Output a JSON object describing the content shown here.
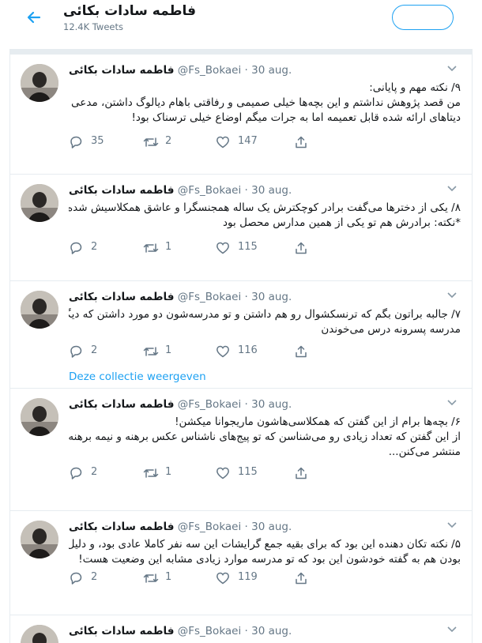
{
  "header": {
    "name": "فاطمه سادات بکائی",
    "tweet_count": "12.4K Tweets"
  },
  "tweets": [
    {
      "name": "فاطمه سادات بکائی",
      "handle": "@Fs_Bokaei",
      "date": "· 30 aug.",
      "lines": [
        "۹/ نکته مهم و پایانی:",
        "من قصد پژوهش نداشتم و این بچه‌ها خیلی صمیمی و رفاقتی باهام دیالوگ داشتن، مدعی این هم نیستم که",
        "دیتاهای ارائه شده قابل تعمیمه اما به جرات میگم اوضاع خیلی ترسناک بود!"
      ],
      "replies": "35",
      "retweets": "2",
      "likes": "147"
    },
    {
      "name": "فاطمه سادات بکائی",
      "handle": "@Fs_Bokaei",
      "date": "· 30 aug.",
      "lines": [
        "۸/ یکی از دخترها می‌گفت برادر کوچکترش یک ساله همجنسگرا و عاشق همکلاسیش شده!!!!!",
        "*نکته: برادرش هم تو یکی از همین مدارس محصل بود"
      ],
      "replies": "2",
      "retweets": "1",
      "likes": "115"
    },
    {
      "name": "فاطمه سادات بکائی",
      "handle": "@Fs_Bokaei",
      "date": "· 30 aug.",
      "lines": [
        "۷/ جالبه براتون بگم که ترنسکشوال رو هم داشتن و تو مدرسه‌شون دو مورد داشتن که دیگه امسال رو",
        "مدرسه پسرونه درس می‌خوندن"
      ],
      "replies": "2",
      "retweets": "1",
      "likes": "116",
      "collection_link": "Deze collectie weergeven"
    },
    {
      "name": "فاطمه سادات بکائی",
      "handle": "@Fs_Bokaei",
      "date": "· 30 aug.",
      "lines": [
        "۶/ بچه‌ها برام از این گفتن که همکلاسی‌هاشون ماریجوانا میکشن!",
        "از این گفتن که تعداد زیادی رو می‌شناسن که تو پیج‌های ناشناس عکس برهنه و نیمه برهنه از خودشون",
        "منتشر می‌کنن..."
      ],
      "replies": "2",
      "retweets": "1",
      "likes": "115"
    },
    {
      "name": "فاطمه سادات بکائی",
      "handle": "@Fs_Bokaei",
      "date": "· 30 aug.",
      "lines": [
        "۵/ نکته تکان دهنده این بود که برای بقیه جمع گرایشات این سه نفر کاملا عادی بود، و دلیل این عادی",
        "بودن هم به گفته خودشون این بود که تو مدرسه موارد زیادی مشابه این وضعیت هست!"
      ],
      "replies": "2",
      "retweets": "1",
      "likes": "119"
    },
    {
      "name": "فاطمه سادات بکائی",
      "handle": "@Fs_Bokaei",
      "date": "· 30 aug."
    }
  ]
}
